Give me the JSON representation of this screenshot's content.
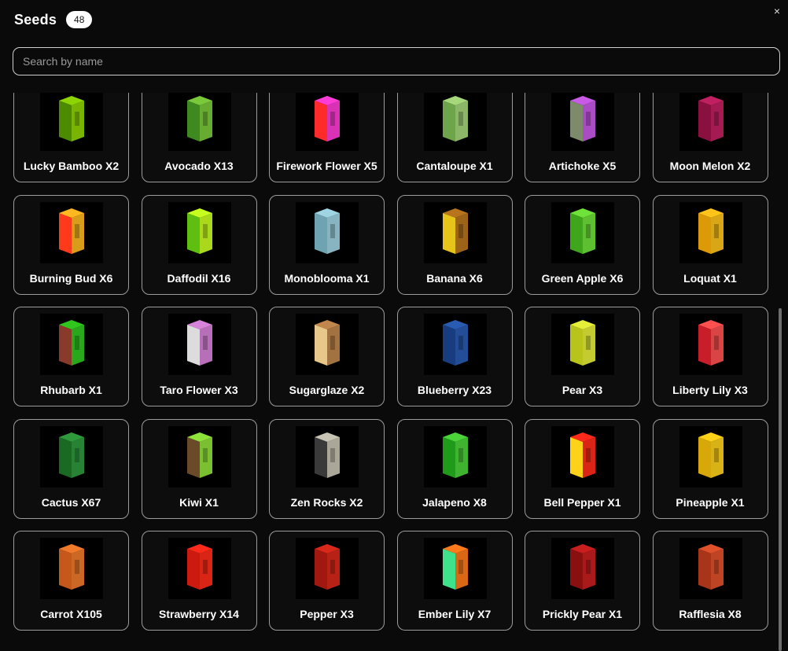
{
  "header": {
    "title": "Seeds",
    "count": "48"
  },
  "search": {
    "placeholder": "Search by name",
    "value": ""
  },
  "close_icon": "×",
  "items": [
    {
      "label": "Lucky Bamboo X2",
      "icon": "lucky-bamboo-icon",
      "top": "#8ed400",
      "side": "#4c8a00"
    },
    {
      "label": "Avocado X13",
      "icon": "avocado-icon",
      "top": "#79c93a",
      "side": "#3e8a20"
    },
    {
      "label": "Firework Flower X5",
      "icon": "firework-flower-icon",
      "top": "#ff3bd6",
      "side": "#ff2a2a"
    },
    {
      "label": "Cantaloupe X1",
      "icon": "cantaloupe-icon",
      "top": "#a6d77a",
      "side": "#6ea44a"
    },
    {
      "label": "Artichoke X5",
      "icon": "artichoke-icon",
      "top": "#c85be6",
      "side": "#7e8b6b"
    },
    {
      "label": "Moon Melon X2",
      "icon": "moon-melon-icon",
      "top": "#c02060",
      "side": "#8a1040"
    },
    {
      "label": "Burning Bud X6",
      "icon": "burning-bud-icon",
      "top": "#ffb81f",
      "side": "#ff3a1a"
    },
    {
      "label": "Daffodil X16",
      "icon": "daffodil-icon",
      "top": "#c7ff1e",
      "side": "#5fbf10"
    },
    {
      "label": "Monoblooma X1",
      "icon": "monoblooma-icon",
      "top": "#9fd4e2",
      "side": "#6ea3b2"
    },
    {
      "label": "Banana X6",
      "icon": "banana-icon",
      "top": "#b8741d",
      "side": "#e6c41a"
    },
    {
      "label": "Green Apple X6",
      "icon": "green-apple-icon",
      "top": "#6fe23a",
      "side": "#3fa51a"
    },
    {
      "label": "Loquat X1",
      "icon": "loquat-icon",
      "top": "#ffc31a",
      "side": "#dd9a08"
    },
    {
      "label": "Rhubarb X1",
      "icon": "rhubarb-icon",
      "top": "#2fc61e",
      "side": "#8a3a2a"
    },
    {
      "label": "Taro Flower X3",
      "icon": "taro-flower-icon",
      "top": "#d783d9",
      "side": "#dcdcdc"
    },
    {
      "label": "Sugarglaze X2",
      "icon": "sugarglaze-icon",
      "top": "#c0864c",
      "side": "#e8c88a"
    },
    {
      "label": "Blueberry X23",
      "icon": "blueberry-icon",
      "top": "#2a5bb2",
      "side": "#173c80"
    },
    {
      "label": "Pear X3",
      "icon": "pear-icon",
      "top": "#e5ef3a",
      "side": "#b9c41a"
    },
    {
      "label": "Liberty Lily X3",
      "icon": "liberty-lily-icon",
      "top": "#ff5050",
      "side": "#c81e2a"
    },
    {
      "label": "Cactus X67",
      "icon": "cactus-icon",
      "top": "#2e9a3c",
      "side": "#1a6a24"
    },
    {
      "label": "Kiwi X1",
      "icon": "kiwi-icon",
      "top": "#8fe23a",
      "side": "#6b4a2a"
    },
    {
      "label": "Zen Rocks X2",
      "icon": "zen-rocks-icon",
      "top": "#c8c4b4",
      "side": "#3a3a3a"
    },
    {
      "label": "Jalapeno X8",
      "icon": "jalapeno-icon",
      "top": "#4bd43a",
      "side": "#1f9a1a"
    },
    {
      "label": "Bell Pepper X1",
      "icon": "bell-pepper-icon",
      "top": "#ff2a1a",
      "side": "#ffd21a"
    },
    {
      "label": "Pineapple X1",
      "icon": "pineapple-icon",
      "top": "#ffd21a",
      "side": "#d8a80a"
    },
    {
      "label": "Carrot X105",
      "icon": "carrot-icon",
      "top": "#f07a2a",
      "side": "#c5581a"
    },
    {
      "label": "Strawberry X14",
      "icon": "strawberry-icon",
      "top": "#ff2a1a",
      "side": "#cc1a10"
    },
    {
      "label": "Pepper X3",
      "icon": "pepper-icon",
      "top": "#d8281a",
      "side": "#a01810"
    },
    {
      "label": "Ember Lily X7",
      "icon": "ember-lily-icon",
      "top": "#ff7a1a",
      "side": "#3fe28a"
    },
    {
      "label": "Prickly Pear X1",
      "icon": "prickly-pear-icon",
      "top": "#c81e1e",
      "side": "#8a1010"
    },
    {
      "label": "Rafflesia X8",
      "icon": "rafflesia-icon",
      "top": "#e0502a",
      "side": "#a8341a"
    }
  ]
}
